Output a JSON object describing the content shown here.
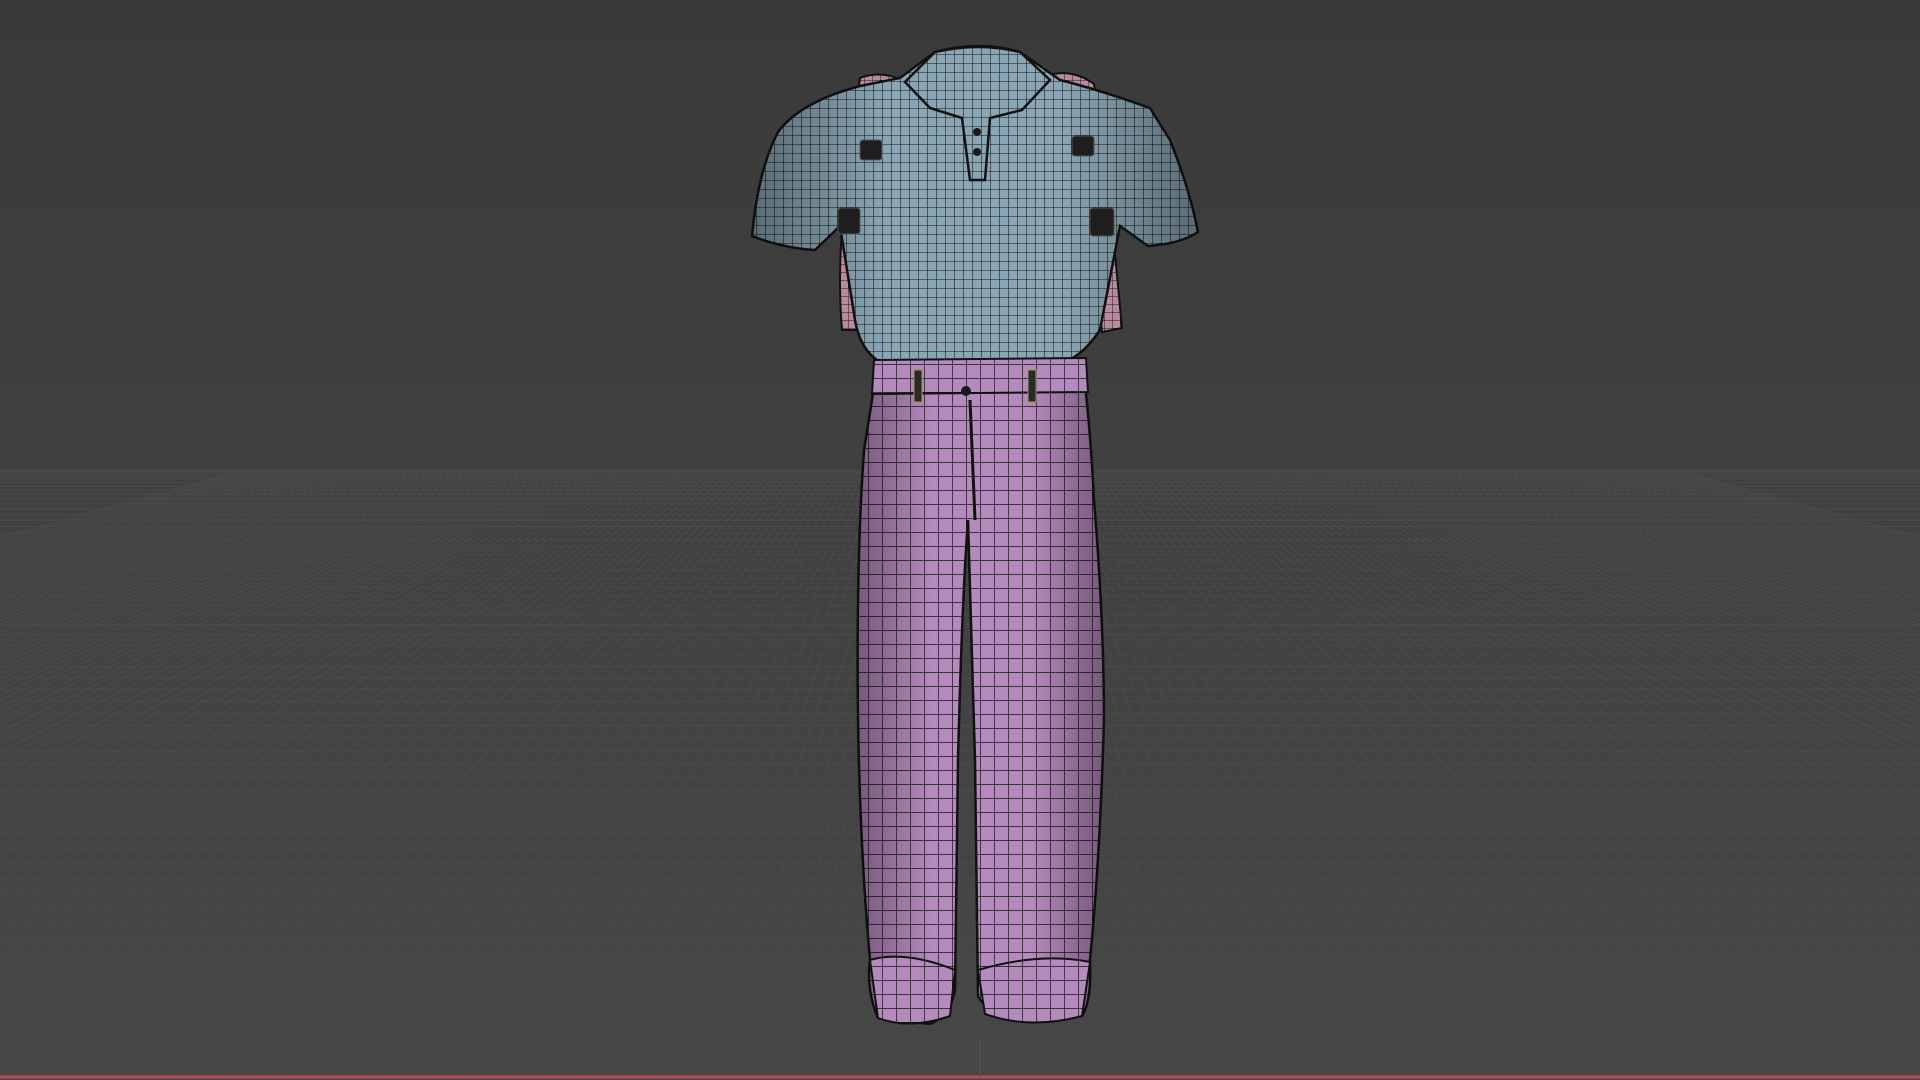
{
  "viewport": {
    "view": "front",
    "shading": "wireframe-overlay",
    "colors": {
      "background": "#3d3d3d",
      "grid_line": "#4a4a4a",
      "x_axis": "#c04a55",
      "shirt_fill": "#7f9aa8",
      "pants_fill": "#b68bbd",
      "strap_fill": "#b98a9e",
      "wire": "#141414"
    },
    "objects": [
      {
        "name": "polo-shirt",
        "kind": "garment"
      },
      {
        "name": "backpack-straps",
        "kind": "accessory"
      },
      {
        "name": "jeans",
        "kind": "garment"
      }
    ]
  }
}
